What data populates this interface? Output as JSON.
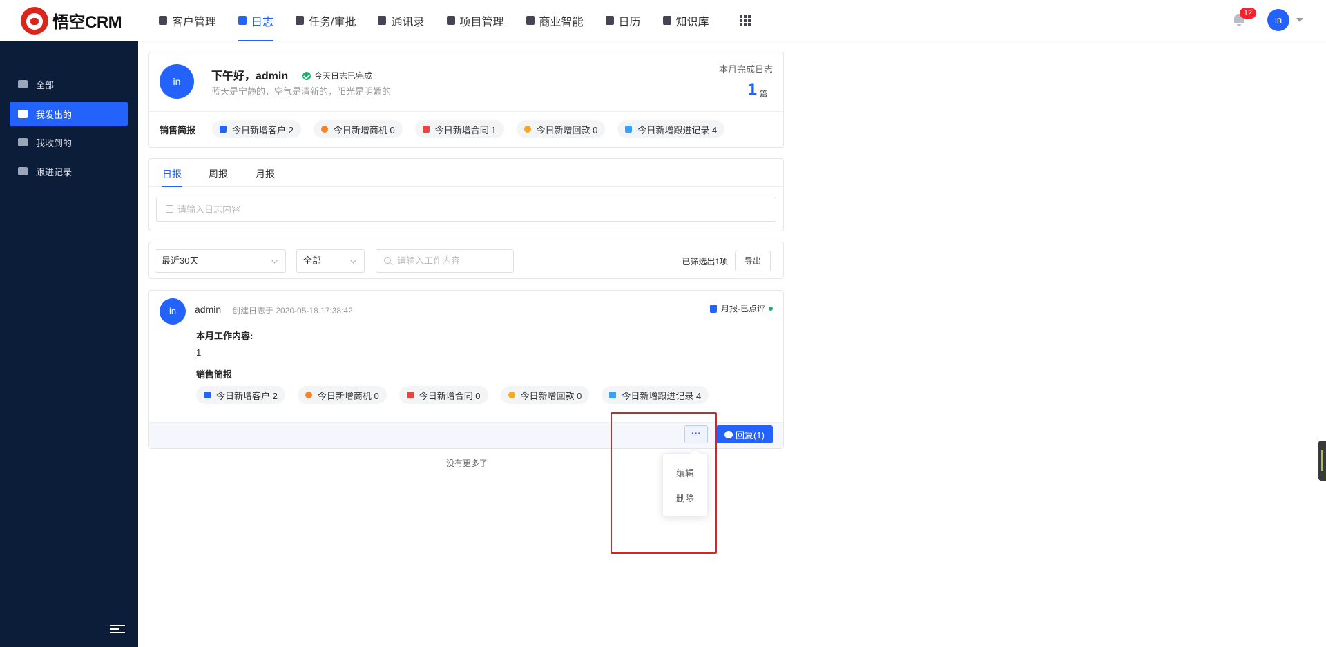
{
  "app": {
    "logo_text": "悟空CRM"
  },
  "nav": {
    "items": [
      {
        "label": "客户管理",
        "icon": "building-icon"
      },
      {
        "label": "日志",
        "icon": "log-icon",
        "active": true
      },
      {
        "label": "任务/审批",
        "icon": "briefcase-icon"
      },
      {
        "label": "通讯录",
        "icon": "phone-book-icon"
      },
      {
        "label": "项目管理",
        "icon": "project-icon"
      },
      {
        "label": "商业智能",
        "icon": "bi-icon"
      },
      {
        "label": "日历",
        "icon": "calendar-icon"
      },
      {
        "label": "知识库",
        "icon": "book-icon"
      }
    ],
    "notification_count": "12",
    "user_avatar": "in"
  },
  "sidebar": {
    "items": [
      {
        "label": "全部",
        "icon": "grid-icon"
      },
      {
        "label": "我发出的",
        "icon": "send-icon",
        "active": true
      },
      {
        "label": "我收到的",
        "icon": "mail-icon"
      },
      {
        "label": "跟进记录",
        "icon": "chat-icon"
      }
    ]
  },
  "summary": {
    "avatar": "in",
    "greeting": "下午好，admin",
    "status": "今天日志已完成",
    "motto": "蓝天是宁静的，空气是清新的，阳光是明媚的",
    "month_label": "本月完成日志",
    "month_count": "1",
    "month_unit": "篇",
    "brief_label": "销售简报",
    "chips": [
      {
        "label": "今日新增客户 2",
        "color": "#2362fb"
      },
      {
        "label": "今日新增商机 0",
        "color": "#f5832b"
      },
      {
        "label": "今日新增合同 1",
        "color": "#e8453c"
      },
      {
        "label": "今日新增回款 0",
        "color": "#f5a623"
      },
      {
        "label": "今日新增跟进记录 4",
        "color": "#3aa0f3"
      }
    ]
  },
  "editor": {
    "tabs": [
      "日报",
      "周报",
      "月报"
    ],
    "placeholder": "请输入日志内容"
  },
  "filters": {
    "range": "最近30天",
    "scope": "全部",
    "search_placeholder": "请输入工作内容",
    "count_text": "已筛选出1项",
    "export_label": "导出"
  },
  "log_entry": {
    "avatar": "in",
    "author": "admin",
    "created": "创建日志于 2020-05-18 17:38:42",
    "tag": "月报-已点评",
    "content_title": "本月工作内容:",
    "content": "1",
    "brief_title": "销售简报",
    "chips": [
      {
        "label": "今日新增客户 2",
        "color": "#2362fb"
      },
      {
        "label": "今日新增商机 0",
        "color": "#f5832b"
      },
      {
        "label": "今日新增合同 0",
        "color": "#e8453c"
      },
      {
        "label": "今日新增回款 0",
        "color": "#f5a623"
      },
      {
        "label": "今日新增跟进记录 4",
        "color": "#3aa0f3"
      }
    ],
    "more_label": "···",
    "reply_label": "回复(1)"
  },
  "list_end": "没有更多了",
  "dropdown": {
    "items": [
      "编辑",
      "删除"
    ]
  }
}
